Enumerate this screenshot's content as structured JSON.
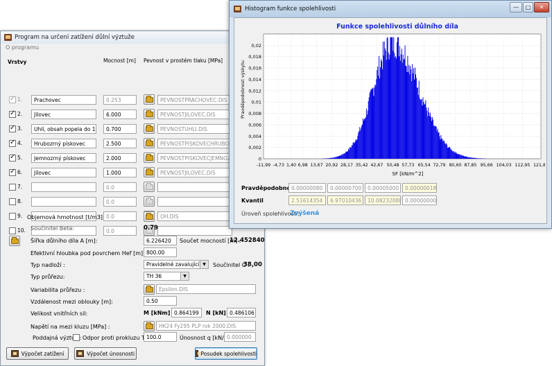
{
  "main_window": {
    "title": "Program na určení zatížení důlní výztuže",
    "menu": "O programu",
    "headers": {
      "layers": "Vrstvy",
      "thickness": "Mocnost [m]",
      "strength": "Pevnost v prostém tlaku [MPa]"
    },
    "layers": [
      {
        "num": "1.",
        "checked": true,
        "disabled": true,
        "name": "Prachovec",
        "thickness": "0.253",
        "thickness_disabled": true,
        "file": "PEVNOSTPRACHOVEC.DIS",
        "button_disabled": false
      },
      {
        "num": "2.",
        "checked": true,
        "disabled": false,
        "name": "Jílovec",
        "thickness": "6.000",
        "thickness_disabled": false,
        "file": "PEVNOSTJILOVEC.DIS",
        "button_disabled": false
      },
      {
        "num": "3.",
        "checked": true,
        "disabled": false,
        "name": "Uhlí, obsah popela do 10%",
        "thickness": "0.700",
        "thickness_disabled": false,
        "file": "PEVNOSTUHLI.DIS",
        "button_disabled": false
      },
      {
        "num": "4.",
        "checked": true,
        "disabled": false,
        "name": "Hrubozrný pískovec",
        "thickness": "2.500",
        "thickness_disabled": false,
        "file": "PEVNOSTPISKOVECHRUBOZ",
        "button_disabled": false
      },
      {
        "num": "5.",
        "checked": true,
        "disabled": false,
        "name": "Jemnozrný pískovec",
        "thickness": "2.000",
        "thickness_disabled": false,
        "file": "PEVNOSTPISKOVECJEMNOZ",
        "button_disabled": false
      },
      {
        "num": "6.",
        "checked": true,
        "disabled": false,
        "name": "Jílovec",
        "thickness": "1.000",
        "thickness_disabled": false,
        "file": "PEVNOSTJILOVEC.DIS",
        "button_disabled": false
      },
      {
        "num": "7.",
        "checked": false,
        "disabled": false,
        "name": "",
        "thickness": "0.0",
        "thickness_disabled": true,
        "file": "",
        "button_disabled": true
      },
      {
        "num": "8.",
        "checked": false,
        "disabled": false,
        "name": "",
        "thickness": "0.0",
        "thickness_disabled": true,
        "file": "",
        "button_disabled": true
      },
      {
        "num": "9.",
        "checked": false,
        "disabled": false,
        "name": "",
        "thickness": "0.0",
        "thickness_disabled": true,
        "file": "",
        "button_disabled": true
      },
      {
        "num": "10.",
        "checked": false,
        "disabled": false,
        "name": "",
        "thickness": "0.0",
        "thickness_disabled": true,
        "file": "",
        "button_disabled": true
      }
    ],
    "volumetric_weight_label": "Objemová hmotnost [t/m3]",
    "volumetric_weight_file": "OH.DIS",
    "beta_label": "Součinitel Beta:",
    "beta_value": "0.79",
    "width_label": "Šířka důlního díla A [m]:",
    "width_value": "6.226420",
    "thickness_sum_label": "Součet mocností [m] :",
    "thickness_sum_value": "12.452840",
    "depth_label": "Efektivní hloubka pod povrchem Hef [m]:",
    "depth_value": "800.00",
    "overburden_label": "Typ nadloží :",
    "overburden_value": "Pravidelné zavalující",
    "coef_c_label": "Součinitel C :",
    "coef_c_value": "38,00",
    "profile_type_label": "Typ průřezu:",
    "profile_type_value": "TH 36",
    "profile_var_label": "Variabilita průřezu :",
    "profile_var_file": "Epsilon.DIS",
    "arch_distance_label": "Vzdálenost mezi oblouky [m]:",
    "arch_distance_value": "0.50",
    "internal_forces_label": "Velikost vnitřních sil:",
    "moment_label": "M [kNm] :",
    "moment_value": "0.864199",
    "normal_label": "N [kN] :",
    "normal_value": "0.486106",
    "yield_stress_label": "Napětí na mezi kluzu [MPa] :",
    "yield_stress_file": "HK24 Fy295 PLP rok 2000.DIS",
    "flexible_label": "Poddajná výztuž :",
    "slip_resistance_label": "Odpor proti prokluzu T [kN] :",
    "slip_resistance_value": "100.0",
    "capacity_label": "Únosnost q [kN/m] :",
    "capacity_value": "0.000000",
    "buttons": {
      "load": "Výpočet zatížení",
      "capacity": "Výpočet únosnosti",
      "assessment": "Posudek spolehlivosti"
    }
  },
  "hist_window": {
    "title": "Histogram funkce spolehlivosti",
    "controls": {
      "minimize": "—",
      "maximize": "□",
      "close": "✕"
    },
    "probability_label": "Pravděpodobnost:",
    "probability_values": [
      "0.00000080",
      "0.00000700",
      "0.00005000",
      "0.00000018"
    ],
    "quantile_label": "Kvantil",
    "quantile_values": [
      "2.51614354",
      "6.97010436",
      "10.08232088",
      "0.00000000"
    ],
    "reliability_label": "Úroveň spolehlivosti:",
    "reliability_value": "Zvýšená",
    "colors": {
      "bars": "#0000e6",
      "title": "#1a2bd6",
      "reliability": "#3a8fd8"
    }
  },
  "chart_data": {
    "type": "bar",
    "title": "Funkce spolehlivosti důlního díla",
    "xlabel": "SF [kN/m^2]",
    "ylabel": "Pravděpodobnost výskytu",
    "x_ticks": [
      "-11,99",
      "-4,73",
      "1,40",
      "6,98",
      "13,67",
      "20,92",
      "28,17",
      "35,42",
      "42,67",
      "50,48",
      "57,73",
      "65,54",
      "72,79",
      "80,60",
      "87,85",
      "95,66",
      "104,03",
      "112,95",
      "121,87"
    ],
    "y_ticks": [
      "0",
      "0,002",
      "0,004",
      "0,006",
      "0,008",
      "0,01",
      "0,012",
      "0,014",
      "0,016",
      "0,018",
      "0,02"
    ],
    "xlim": [
      -11.99,
      121.87
    ],
    "ylim": [
      0,
      0.022
    ],
    "grid": true,
    "peak_x": 50.48,
    "peak_y": 0.0206,
    "bins": 280
  }
}
